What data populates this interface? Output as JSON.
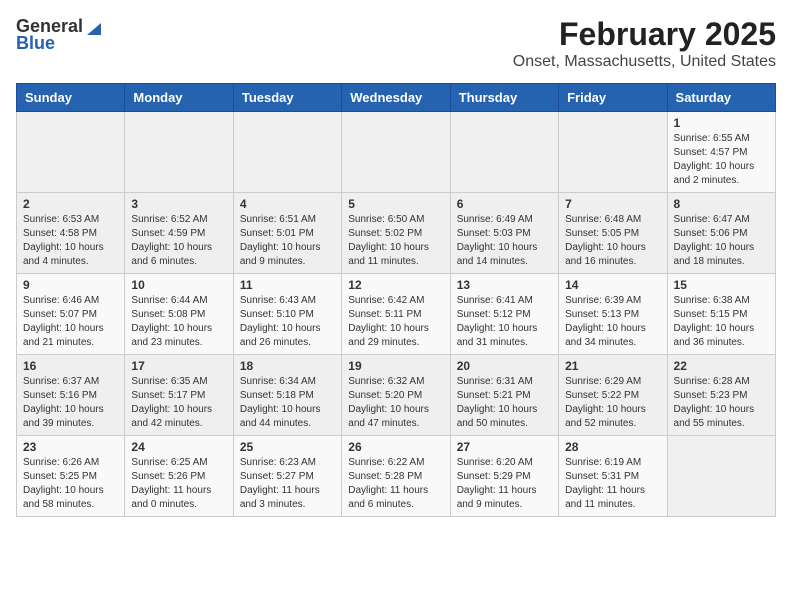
{
  "logo": {
    "general": "General",
    "blue": "Blue"
  },
  "title": "February 2025",
  "subtitle": "Onset, Massachusetts, United States",
  "days_of_week": [
    "Sunday",
    "Monday",
    "Tuesday",
    "Wednesday",
    "Thursday",
    "Friday",
    "Saturday"
  ],
  "weeks": [
    [
      {
        "day": "",
        "info": ""
      },
      {
        "day": "",
        "info": ""
      },
      {
        "day": "",
        "info": ""
      },
      {
        "day": "",
        "info": ""
      },
      {
        "day": "",
        "info": ""
      },
      {
        "day": "",
        "info": ""
      },
      {
        "day": "1",
        "info": "Sunrise: 6:55 AM\nSunset: 4:57 PM\nDaylight: 10 hours\nand 2 minutes."
      }
    ],
    [
      {
        "day": "2",
        "info": "Sunrise: 6:53 AM\nSunset: 4:58 PM\nDaylight: 10 hours\nand 4 minutes."
      },
      {
        "day": "3",
        "info": "Sunrise: 6:52 AM\nSunset: 4:59 PM\nDaylight: 10 hours\nand 6 minutes."
      },
      {
        "day": "4",
        "info": "Sunrise: 6:51 AM\nSunset: 5:01 PM\nDaylight: 10 hours\nand 9 minutes."
      },
      {
        "day": "5",
        "info": "Sunrise: 6:50 AM\nSunset: 5:02 PM\nDaylight: 10 hours\nand 11 minutes."
      },
      {
        "day": "6",
        "info": "Sunrise: 6:49 AM\nSunset: 5:03 PM\nDaylight: 10 hours\nand 14 minutes."
      },
      {
        "day": "7",
        "info": "Sunrise: 6:48 AM\nSunset: 5:05 PM\nDaylight: 10 hours\nand 16 minutes."
      },
      {
        "day": "8",
        "info": "Sunrise: 6:47 AM\nSunset: 5:06 PM\nDaylight: 10 hours\nand 18 minutes."
      }
    ],
    [
      {
        "day": "9",
        "info": "Sunrise: 6:46 AM\nSunset: 5:07 PM\nDaylight: 10 hours\nand 21 minutes."
      },
      {
        "day": "10",
        "info": "Sunrise: 6:44 AM\nSunset: 5:08 PM\nDaylight: 10 hours\nand 23 minutes."
      },
      {
        "day": "11",
        "info": "Sunrise: 6:43 AM\nSunset: 5:10 PM\nDaylight: 10 hours\nand 26 minutes."
      },
      {
        "day": "12",
        "info": "Sunrise: 6:42 AM\nSunset: 5:11 PM\nDaylight: 10 hours\nand 29 minutes."
      },
      {
        "day": "13",
        "info": "Sunrise: 6:41 AM\nSunset: 5:12 PM\nDaylight: 10 hours\nand 31 minutes."
      },
      {
        "day": "14",
        "info": "Sunrise: 6:39 AM\nSunset: 5:13 PM\nDaylight: 10 hours\nand 34 minutes."
      },
      {
        "day": "15",
        "info": "Sunrise: 6:38 AM\nSunset: 5:15 PM\nDaylight: 10 hours\nand 36 minutes."
      }
    ],
    [
      {
        "day": "16",
        "info": "Sunrise: 6:37 AM\nSunset: 5:16 PM\nDaylight: 10 hours\nand 39 minutes."
      },
      {
        "day": "17",
        "info": "Sunrise: 6:35 AM\nSunset: 5:17 PM\nDaylight: 10 hours\nand 42 minutes."
      },
      {
        "day": "18",
        "info": "Sunrise: 6:34 AM\nSunset: 5:18 PM\nDaylight: 10 hours\nand 44 minutes."
      },
      {
        "day": "19",
        "info": "Sunrise: 6:32 AM\nSunset: 5:20 PM\nDaylight: 10 hours\nand 47 minutes."
      },
      {
        "day": "20",
        "info": "Sunrise: 6:31 AM\nSunset: 5:21 PM\nDaylight: 10 hours\nand 50 minutes."
      },
      {
        "day": "21",
        "info": "Sunrise: 6:29 AM\nSunset: 5:22 PM\nDaylight: 10 hours\nand 52 minutes."
      },
      {
        "day": "22",
        "info": "Sunrise: 6:28 AM\nSunset: 5:23 PM\nDaylight: 10 hours\nand 55 minutes."
      }
    ],
    [
      {
        "day": "23",
        "info": "Sunrise: 6:26 AM\nSunset: 5:25 PM\nDaylight: 10 hours\nand 58 minutes."
      },
      {
        "day": "24",
        "info": "Sunrise: 6:25 AM\nSunset: 5:26 PM\nDaylight: 11 hours\nand 0 minutes."
      },
      {
        "day": "25",
        "info": "Sunrise: 6:23 AM\nSunset: 5:27 PM\nDaylight: 11 hours\nand 3 minutes."
      },
      {
        "day": "26",
        "info": "Sunrise: 6:22 AM\nSunset: 5:28 PM\nDaylight: 11 hours\nand 6 minutes."
      },
      {
        "day": "27",
        "info": "Sunrise: 6:20 AM\nSunset: 5:29 PM\nDaylight: 11 hours\nand 9 minutes."
      },
      {
        "day": "28",
        "info": "Sunrise: 6:19 AM\nSunset: 5:31 PM\nDaylight: 11 hours\nand 11 minutes."
      },
      {
        "day": "",
        "info": ""
      }
    ]
  ]
}
